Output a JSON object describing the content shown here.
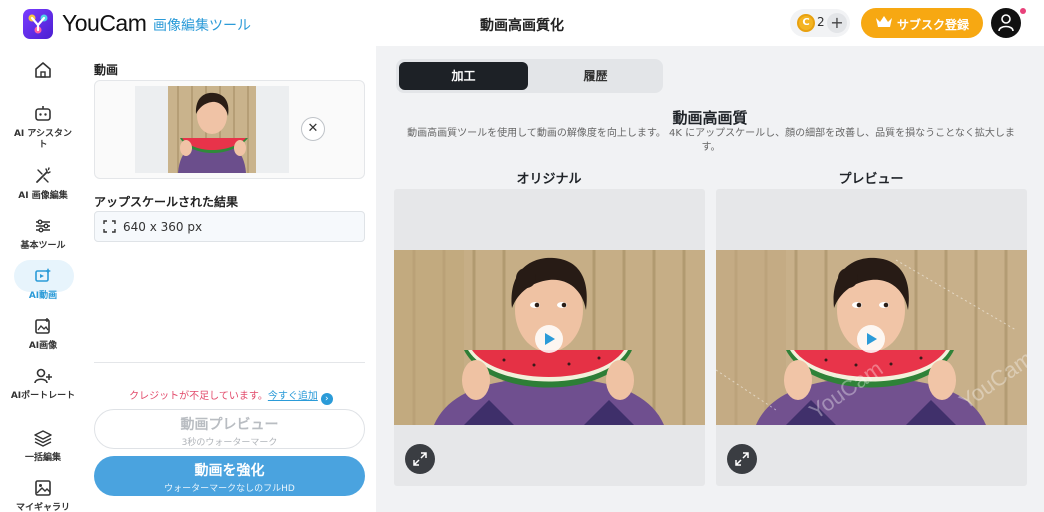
{
  "header": {
    "brand": "YouCam",
    "brand_sub": "画像編集ツール",
    "page_title": "動画高画質化",
    "credits": "2",
    "subscribe_label": "サブスク登録"
  },
  "sidebar": {
    "items": [
      {
        "label": "",
        "icon": "home-icon"
      },
      {
        "label": "AI アシスタント",
        "icon": "assistant-icon"
      },
      {
        "label": "AI 画像編集",
        "icon": "magic-wand-icon"
      },
      {
        "label": "基本ツール",
        "icon": "sliders-icon"
      },
      {
        "label": "AI動画",
        "icon": "video-icon",
        "active": true
      },
      {
        "label": "AI画像",
        "icon": "image-plus-icon"
      },
      {
        "label": "AIポートレート",
        "icon": "user-plus-icon"
      },
      {
        "label": "一括編集",
        "icon": "layers-icon"
      },
      {
        "label": "マイギャラリ",
        "icon": "gallery-icon"
      }
    ]
  },
  "panel": {
    "video_label": "動画",
    "result_label": "アップスケールされた結果",
    "resolution": "640 x 360 px",
    "credit_warning": "クレジットが不足しています。",
    "add_now": "今すぐ追加",
    "preview_title": "動画プレビュー",
    "preview_sub": "3秒のウォーターマーク",
    "enhance_title": "動画を強化",
    "enhance_sub": "ウォーターマークなしのフルHD"
  },
  "main": {
    "tabs": [
      {
        "label": "加工",
        "active": true
      },
      {
        "label": "履歴",
        "active": false
      }
    ],
    "title": "動画高画質",
    "description": "動画高画質ツールを使用して動画の解像度を向上します。 4K にアップスケールし、顔の細部を改善し、品質を損なうことなく拡大します。",
    "original_label": "オリジナル",
    "preview_label": "プレビュー"
  },
  "colors": {
    "accent_blue": "#2b9bd8",
    "button_blue": "#4aa3df",
    "subscribe_orange": "#f7a812",
    "warning_pink": "#e24a6b",
    "tab_dark": "#1d2126"
  }
}
